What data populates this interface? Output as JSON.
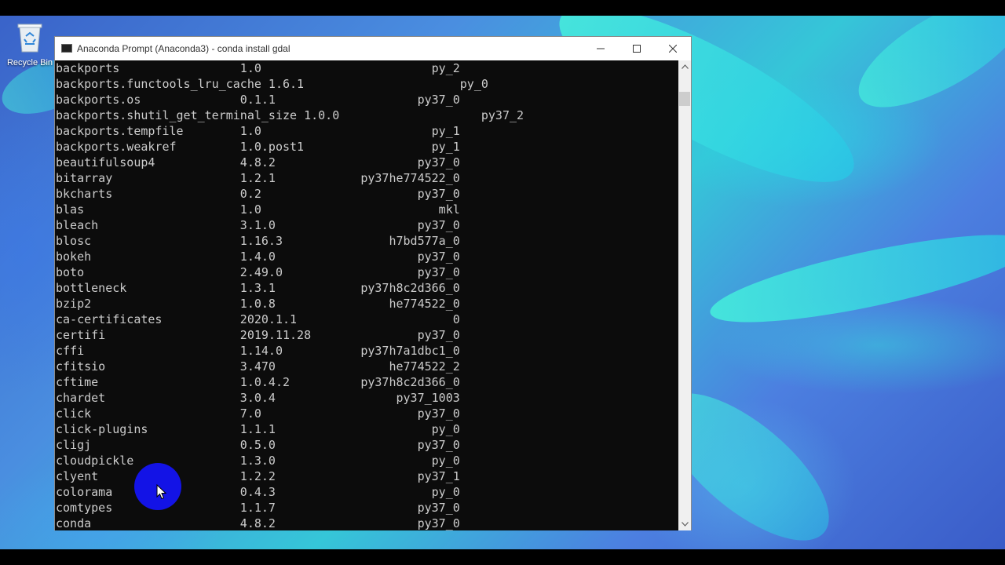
{
  "desktop": {
    "recycle_bin_label": "Recycle Bin"
  },
  "window": {
    "title": "Anaconda Prompt (Anaconda3) - conda  install gdal",
    "icons": {
      "app": "console-icon",
      "minimize": "minimize-icon",
      "maximize": "maximize-icon",
      "close": "close-icon"
    }
  },
  "console": {
    "lines": [
      "backports                 1.0                        py_2",
      "backports.functools_lru_cache 1.6.1                      py_0",
      "backports.os              0.1.1                    py37_0",
      "backports.shutil_get_terminal_size 1.0.0                    py37_2",
      "backports.tempfile        1.0                        py_1",
      "backports.weakref         1.0.post1                  py_1",
      "beautifulsoup4            4.8.2                    py37_0",
      "bitarray                  1.2.1            py37he774522_0",
      "bkcharts                  0.2                      py37_0",
      "blas                      1.0                         mkl",
      "bleach                    3.1.0                    py37_0",
      "blosc                     1.16.3               h7bd577a_0",
      "bokeh                     1.4.0                    py37_0",
      "boto                      2.49.0                   py37_0",
      "bottleneck                1.3.1            py37h8c2d366_0",
      "bzip2                     1.0.8                he774522_0",
      "ca-certificates           2020.1.1                      0",
      "certifi                   2019.11.28               py37_0",
      "cffi                      1.14.0           py37h7a1dbc1_0",
      "cfitsio                   3.470                he774522_2",
      "cftime                    1.0.4.2          py37h8c2d366_0",
      "chardet                   3.0.4                 py37_1003",
      "click                     7.0                      py37_0",
      "click-plugins             1.1.1                      py_0",
      "cligj                     0.5.0                    py37_0",
      "cloudpickle               1.3.0                      py_0",
      "clyent                    1.2.2                    py37_1",
      "colorama                  0.4.3                      py_0",
      "comtypes                  1.1.7                    py37_0",
      "conda                     4.8.2                    py37_0"
    ]
  },
  "colors": {
    "console_bg": "#0c0c0c",
    "console_fg": "#cccccc",
    "cursor_highlight": "#1313e6"
  }
}
